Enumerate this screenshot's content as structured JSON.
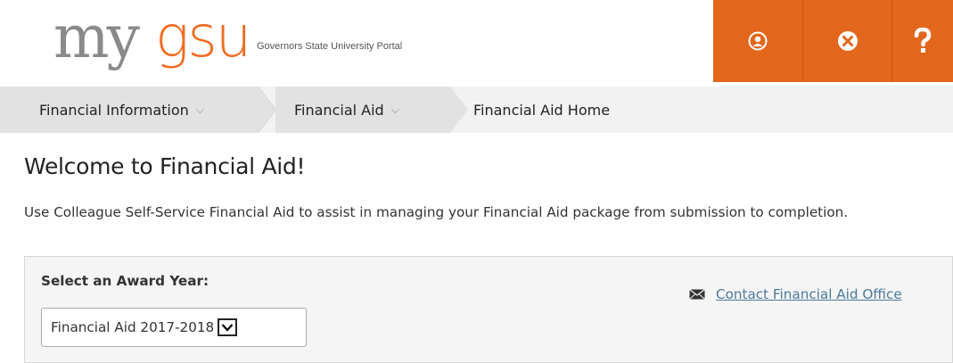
{
  "header": {
    "logo_my": "my",
    "logo_gsu": "gsu",
    "logo_tagline": "Governors State University Portal",
    "brand_color": "#e2671d",
    "icons": [
      "user-icon",
      "sign-out-icon",
      "help-icon"
    ]
  },
  "breadcrumb": {
    "items": [
      {
        "label": "Financial Information"
      },
      {
        "label": "Financial Aid"
      },
      {
        "label": "Financial Aid Home"
      }
    ]
  },
  "page": {
    "title": "Welcome to Financial Aid!",
    "intro": "Use Colleague Self-Service Financial Aid to assist in managing your Financial Aid package from submission to completion."
  },
  "award_year": {
    "label": "Select an Award Year:",
    "selected": "Financial Aid 2017-2018"
  },
  "contact": {
    "link_text": "Contact Financial Aid Office",
    "icon": "envelope-icon"
  }
}
